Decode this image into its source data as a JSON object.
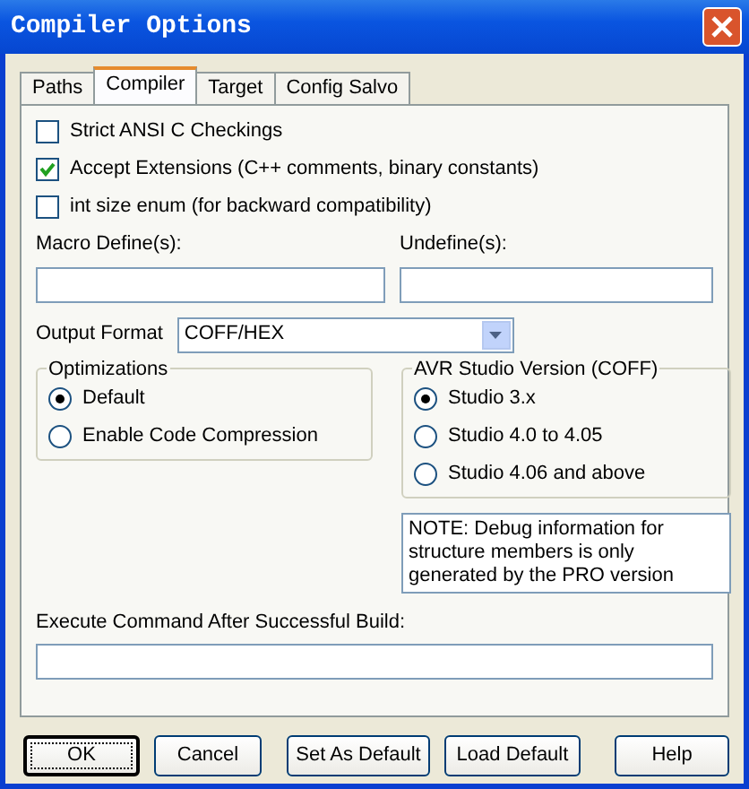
{
  "window": {
    "title": "Compiler Options"
  },
  "tabs": [
    {
      "label": "Paths",
      "selected": false
    },
    {
      "label": "Compiler",
      "selected": true
    },
    {
      "label": "Target",
      "selected": false
    },
    {
      "label": "Config Salvo",
      "selected": false
    }
  ],
  "checkboxes": [
    {
      "label": "Strict ANSI C Checkings",
      "checked": false
    },
    {
      "label": "Accept Extensions (C++ comments, binary constants)",
      "checked": true
    },
    {
      "label": "int size enum (for backward compatibility)",
      "checked": false
    }
  ],
  "macro_define": {
    "label": "Macro Define(s):"
  },
  "undefine": {
    "label": "Undefine(s):"
  },
  "output_format": {
    "label": "Output Format",
    "value": "COFF/HEX"
  },
  "optimizations": {
    "title": "Optimizations",
    "options": [
      {
        "label": "Default",
        "selected": true
      },
      {
        "label": "Enable Code Compression",
        "selected": false
      }
    ]
  },
  "avr_studio_version": {
    "title": "AVR Studio Version (COFF)",
    "options": [
      {
        "label": "Studio 3.x",
        "selected": true
      },
      {
        "label": "Studio 4.0 to 4.05",
        "selected": false
      },
      {
        "label": "Studio 4.06 and above",
        "selected": false
      }
    ]
  },
  "note": "NOTE: Debug information for structure members is only generated by the PRO version",
  "execute_command": {
    "label": "Execute Command After Successful Build:"
  },
  "buttons": [
    {
      "label": "OK",
      "default": true
    },
    {
      "label": "Cancel",
      "default": false
    },
    {
      "label": "Set As Default",
      "default": false
    },
    {
      "label": "Load Default",
      "default": false
    },
    {
      "label": "Help",
      "default": false
    }
  ]
}
